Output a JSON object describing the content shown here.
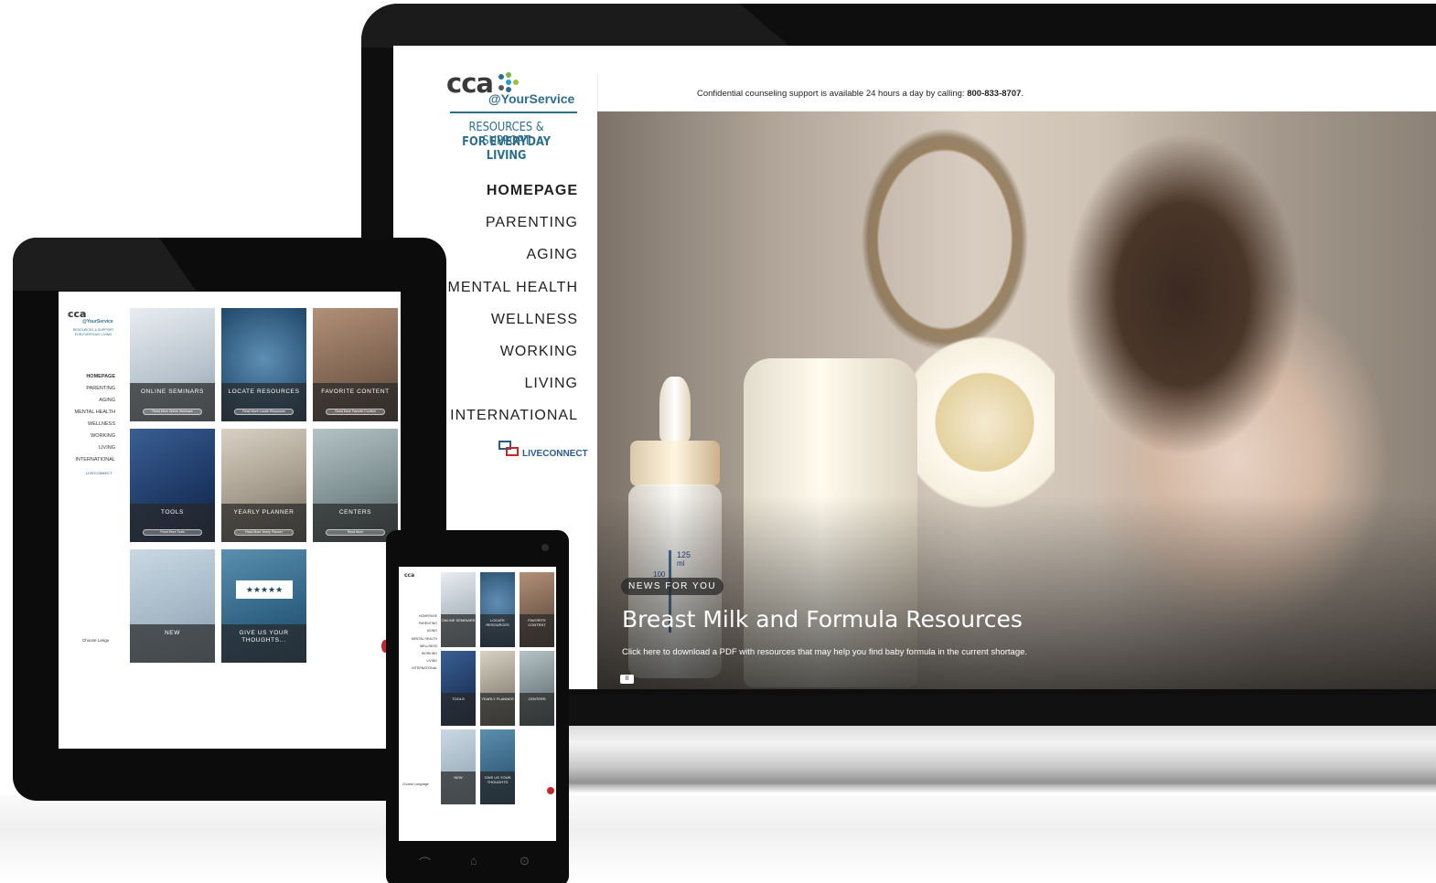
{
  "laptop": {
    "logo": {
      "brand": "cca",
      "sub": "@YourService",
      "tagline_line1": "RESOURCES & SUPPORT",
      "tagline_line2": "FOR EVERYDAY LIVING",
      "dot_colors": [
        "#2f6e8a",
        "#7ab648",
        "#2a9ad6",
        "#9bc23c",
        "#5a5a5a",
        "#2f6e8a"
      ]
    },
    "nav": [
      "HOMEPAGE",
      "PARENTING",
      "AGING",
      "MENTAL HEALTH",
      "WELLNESS",
      "WORKING",
      "LIVING",
      "INTERNATIONAL"
    ],
    "liveconnect": "LIVECONNECT",
    "topbar": {
      "text": "Confidential counseling support is available 24 hours a day by calling:",
      "phone": "800-833-8707",
      "suffix": "."
    },
    "hero": {
      "badge": "NEWS FOR YOU",
      "title": "Breast Milk and Formula Resources",
      "subtitle": "Click here to download a PDF with resources that may help you find baby formula in the current shortage.",
      "pause": "II",
      "scale_top": "125",
      "scale_unit": "ml",
      "scale_mid": "100"
    }
  },
  "tablet": {
    "logo": {
      "brand": "cca",
      "sub": "@YourService",
      "tagline": "RESOURCES & SUPPORT FOR EVERYDAY LIVING"
    },
    "nav": [
      "HOMEPAGE",
      "PARENTING",
      "AGING",
      "MENTAL HEALTH",
      "WELLNESS",
      "WORKING",
      "LIVING",
      "INTERNATIONAL"
    ],
    "liveconnect": "LIVECONNECT",
    "language": "Choose Langu",
    "tiles": [
      {
        "label": "ONLINE SEMINARS",
        "button": "Read More Online Seminars"
      },
      {
        "label": "LOCATE RESOURCES",
        "button": "Read More Locate Resources"
      },
      {
        "label": "FAVORITE CONTENT",
        "button": "Read More Favorite Content"
      },
      {
        "label": "TOOLS",
        "button": "Read More Tools"
      },
      {
        "label": "YEARLY PLANNER",
        "button": "Read More Yearly Planner"
      },
      {
        "label": "CENTERS",
        "button": "Read More"
      },
      {
        "label": "NEW",
        "button": ""
      },
      {
        "label": "GIVE US YOUR THOUGHTS...",
        "button": ""
      }
    ],
    "stars": "★★★★★"
  },
  "phone": {
    "logo": "cca",
    "nav": [
      "HOMEPAGE",
      "PARENTING",
      "AGING",
      "MENTAL HEALTH",
      "WELLNESS",
      "WORKING",
      "LIVING",
      "INTERNATIONAL"
    ],
    "tiles": [
      "ONLINE SEMINARS",
      "LOCATE RESOURCES",
      "FAVORITE CONTENT",
      "TOOLS",
      "YEARLY PLANNER",
      "CENTERS",
      "NEW",
      "GIVE US YOUR THOUGHTS"
    ],
    "language": "Choose Language",
    "keys": {
      "back": "⌒",
      "home": "⌂",
      "recent": "⊙"
    }
  }
}
